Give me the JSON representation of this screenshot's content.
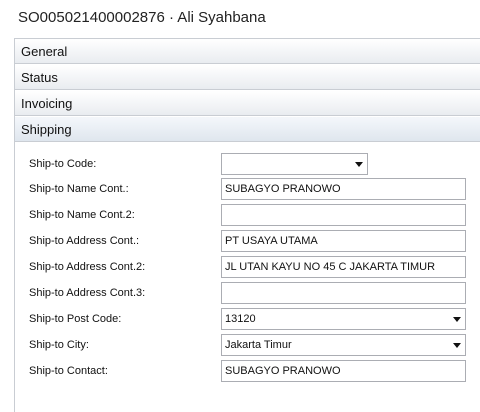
{
  "window": {
    "title": "SO005021400002876 · Ali Syahbana"
  },
  "sections": {
    "general": "General",
    "status": "Status",
    "invoicing": "Invoicing",
    "shipping": "Shipping"
  },
  "shipping": {
    "fields": [
      {
        "label": "Ship-to Code:",
        "value": "",
        "type": "dropdown"
      },
      {
        "label": "Ship-to Name Cont.:",
        "value": "SUBAGYO PRANOWO",
        "type": "text"
      },
      {
        "label": "Ship-to Name Cont.2:",
        "value": "",
        "type": "text"
      },
      {
        "label": "Ship-to Address Cont.:",
        "value": "PT USAYA UTAMA",
        "type": "text"
      },
      {
        "label": "Ship-to Address Cont.2:",
        "value": "JL UTAN KAYU NO 45 C JAKARTA TIMUR",
        "type": "text"
      },
      {
        "label": "Ship-to Address Cont.3:",
        "value": "",
        "type": "text"
      },
      {
        "label": "Ship-to Post Code:",
        "value": "13120",
        "type": "dropdown"
      },
      {
        "label": "Ship-to City:",
        "value": "Jakarta Timur",
        "type": "dropdown"
      },
      {
        "label": "Ship-to Contact:",
        "value": "SUBAGYO PRANOWO",
        "type": "text"
      }
    ]
  },
  "colors": {
    "border": "#c9cdd3",
    "input_border": "#abadb3"
  }
}
